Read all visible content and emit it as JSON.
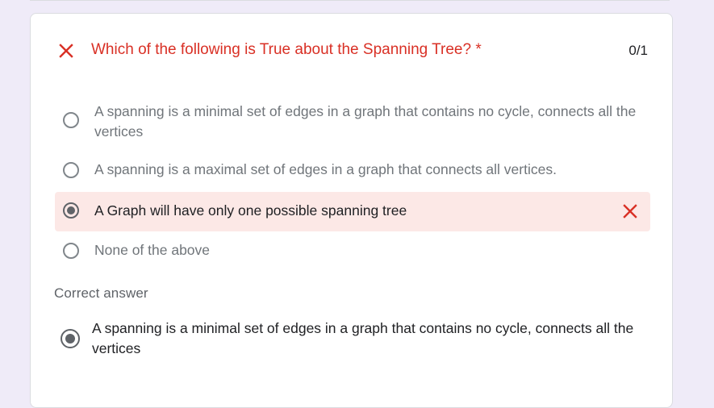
{
  "question": {
    "title": "Which of the following is True about the Spanning Tree? *",
    "score": "0/1",
    "status_icon": "close-icon",
    "error_color": "#d93025"
  },
  "options": [
    {
      "text": "A spanning is a minimal set of edges in a graph that contains no cycle, connects all the vertices",
      "selected": false,
      "marked_wrong": false
    },
    {
      "text": "A spanning is a maximal set of edges in a graph that connects all vertices.",
      "selected": false,
      "marked_wrong": false
    },
    {
      "text": "A Graph will have only one possible spanning tree",
      "selected": true,
      "marked_wrong": true
    },
    {
      "text": "None of the above",
      "selected": false,
      "marked_wrong": false
    }
  ],
  "correct_answer": {
    "label": "Correct answer",
    "text": "A spanning is a minimal set of edges in a graph that contains no cycle, connects all the vertices",
    "selected": true
  },
  "colors": {
    "background": "#efebf8",
    "wrong_highlight": "#fce8e6",
    "radio": "#5f6368"
  }
}
